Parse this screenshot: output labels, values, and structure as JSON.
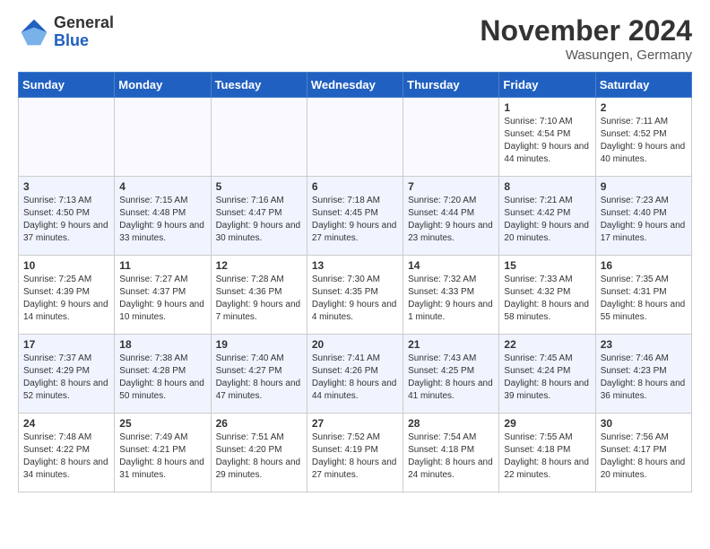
{
  "header": {
    "logo_general": "General",
    "logo_blue": "Blue",
    "month_title": "November 2024",
    "location": "Wasungen, Germany"
  },
  "weekdays": [
    "Sunday",
    "Monday",
    "Tuesday",
    "Wednesday",
    "Thursday",
    "Friday",
    "Saturday"
  ],
  "weeks": [
    [
      {
        "day": "",
        "info": ""
      },
      {
        "day": "",
        "info": ""
      },
      {
        "day": "",
        "info": ""
      },
      {
        "day": "",
        "info": ""
      },
      {
        "day": "",
        "info": ""
      },
      {
        "day": "1",
        "info": "Sunrise: 7:10 AM\nSunset: 4:54 PM\nDaylight: 9 hours and 44 minutes."
      },
      {
        "day": "2",
        "info": "Sunrise: 7:11 AM\nSunset: 4:52 PM\nDaylight: 9 hours and 40 minutes."
      }
    ],
    [
      {
        "day": "3",
        "info": "Sunrise: 7:13 AM\nSunset: 4:50 PM\nDaylight: 9 hours and 37 minutes."
      },
      {
        "day": "4",
        "info": "Sunrise: 7:15 AM\nSunset: 4:48 PM\nDaylight: 9 hours and 33 minutes."
      },
      {
        "day": "5",
        "info": "Sunrise: 7:16 AM\nSunset: 4:47 PM\nDaylight: 9 hours and 30 minutes."
      },
      {
        "day": "6",
        "info": "Sunrise: 7:18 AM\nSunset: 4:45 PM\nDaylight: 9 hours and 27 minutes."
      },
      {
        "day": "7",
        "info": "Sunrise: 7:20 AM\nSunset: 4:44 PM\nDaylight: 9 hours and 23 minutes."
      },
      {
        "day": "8",
        "info": "Sunrise: 7:21 AM\nSunset: 4:42 PM\nDaylight: 9 hours and 20 minutes."
      },
      {
        "day": "9",
        "info": "Sunrise: 7:23 AM\nSunset: 4:40 PM\nDaylight: 9 hours and 17 minutes."
      }
    ],
    [
      {
        "day": "10",
        "info": "Sunrise: 7:25 AM\nSunset: 4:39 PM\nDaylight: 9 hours and 14 minutes."
      },
      {
        "day": "11",
        "info": "Sunrise: 7:27 AM\nSunset: 4:37 PM\nDaylight: 9 hours and 10 minutes."
      },
      {
        "day": "12",
        "info": "Sunrise: 7:28 AM\nSunset: 4:36 PM\nDaylight: 9 hours and 7 minutes."
      },
      {
        "day": "13",
        "info": "Sunrise: 7:30 AM\nSunset: 4:35 PM\nDaylight: 9 hours and 4 minutes."
      },
      {
        "day": "14",
        "info": "Sunrise: 7:32 AM\nSunset: 4:33 PM\nDaylight: 9 hours and 1 minute."
      },
      {
        "day": "15",
        "info": "Sunrise: 7:33 AM\nSunset: 4:32 PM\nDaylight: 8 hours and 58 minutes."
      },
      {
        "day": "16",
        "info": "Sunrise: 7:35 AM\nSunset: 4:31 PM\nDaylight: 8 hours and 55 minutes."
      }
    ],
    [
      {
        "day": "17",
        "info": "Sunrise: 7:37 AM\nSunset: 4:29 PM\nDaylight: 8 hours and 52 minutes."
      },
      {
        "day": "18",
        "info": "Sunrise: 7:38 AM\nSunset: 4:28 PM\nDaylight: 8 hours and 50 minutes."
      },
      {
        "day": "19",
        "info": "Sunrise: 7:40 AM\nSunset: 4:27 PM\nDaylight: 8 hours and 47 minutes."
      },
      {
        "day": "20",
        "info": "Sunrise: 7:41 AM\nSunset: 4:26 PM\nDaylight: 8 hours and 44 minutes."
      },
      {
        "day": "21",
        "info": "Sunrise: 7:43 AM\nSunset: 4:25 PM\nDaylight: 8 hours and 41 minutes."
      },
      {
        "day": "22",
        "info": "Sunrise: 7:45 AM\nSunset: 4:24 PM\nDaylight: 8 hours and 39 minutes."
      },
      {
        "day": "23",
        "info": "Sunrise: 7:46 AM\nSunset: 4:23 PM\nDaylight: 8 hours and 36 minutes."
      }
    ],
    [
      {
        "day": "24",
        "info": "Sunrise: 7:48 AM\nSunset: 4:22 PM\nDaylight: 8 hours and 34 minutes."
      },
      {
        "day": "25",
        "info": "Sunrise: 7:49 AM\nSunset: 4:21 PM\nDaylight: 8 hours and 31 minutes."
      },
      {
        "day": "26",
        "info": "Sunrise: 7:51 AM\nSunset: 4:20 PM\nDaylight: 8 hours and 29 minutes."
      },
      {
        "day": "27",
        "info": "Sunrise: 7:52 AM\nSunset: 4:19 PM\nDaylight: 8 hours and 27 minutes."
      },
      {
        "day": "28",
        "info": "Sunrise: 7:54 AM\nSunset: 4:18 PM\nDaylight: 8 hours and 24 minutes."
      },
      {
        "day": "29",
        "info": "Sunrise: 7:55 AM\nSunset: 4:18 PM\nDaylight: 8 hours and 22 minutes."
      },
      {
        "day": "30",
        "info": "Sunrise: 7:56 AM\nSunset: 4:17 PM\nDaylight: 8 hours and 20 minutes."
      }
    ]
  ]
}
